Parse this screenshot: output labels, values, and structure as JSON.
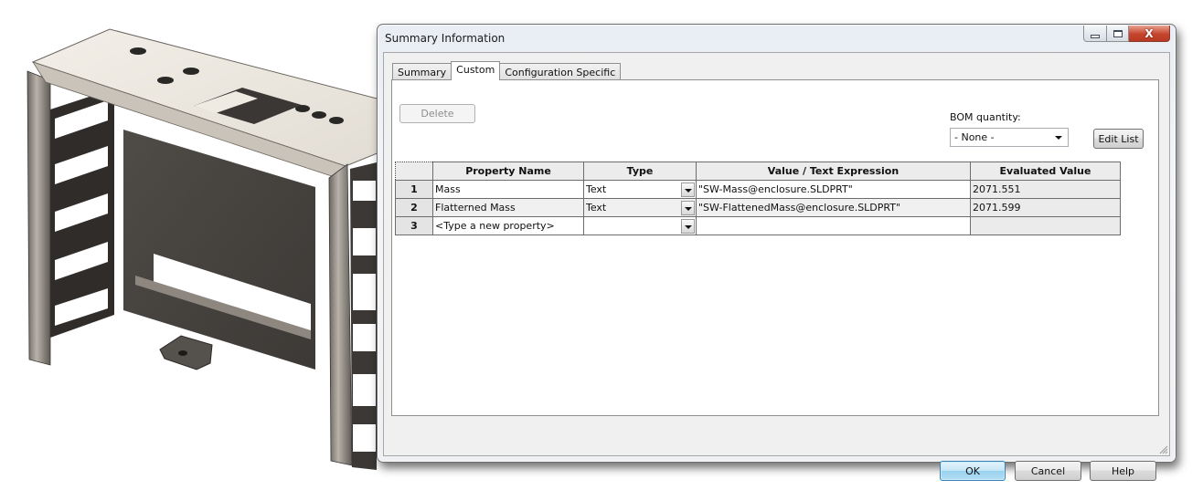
{
  "window": {
    "title": "Summary Information",
    "controls": {
      "minimize_icon": "minimize-icon",
      "maximize_icon": "maximize-icon",
      "close_glyph": "X"
    }
  },
  "tabs": [
    {
      "label": "Summary",
      "active": false
    },
    {
      "label": "Custom",
      "active": true
    },
    {
      "label": "Configuration Specific",
      "active": false
    }
  ],
  "toolbar": {
    "delete_label": "Delete",
    "bom_quantity_label": "BOM quantity:",
    "bom_quantity_value": "- None -",
    "edit_list_label": "Edit List"
  },
  "grid": {
    "columns": [
      "Property Name",
      "Type",
      "Value / Text Expression",
      "Evaluated Value"
    ],
    "rows": [
      {
        "num": "1",
        "name": "Mass",
        "type": "Text",
        "value": "\"SW-Mass@enclosure.SLDPRT\"",
        "evaluated": "2071.551"
      },
      {
        "num": "2",
        "name": "Flatterned Mass",
        "type": "Text",
        "value": "\"SW-FlattenedMass@enclosure.SLDPRT\"",
        "evaluated": "2071.599"
      },
      {
        "num": "3",
        "name": "<Type a new property>",
        "type": "",
        "value": "",
        "evaluated": ""
      }
    ]
  },
  "footer": {
    "ok_label": "OK",
    "cancel_label": "Cancel",
    "help_label": "Help"
  },
  "background": {
    "model_description": "sheet-metal enclosure 3D model"
  }
}
